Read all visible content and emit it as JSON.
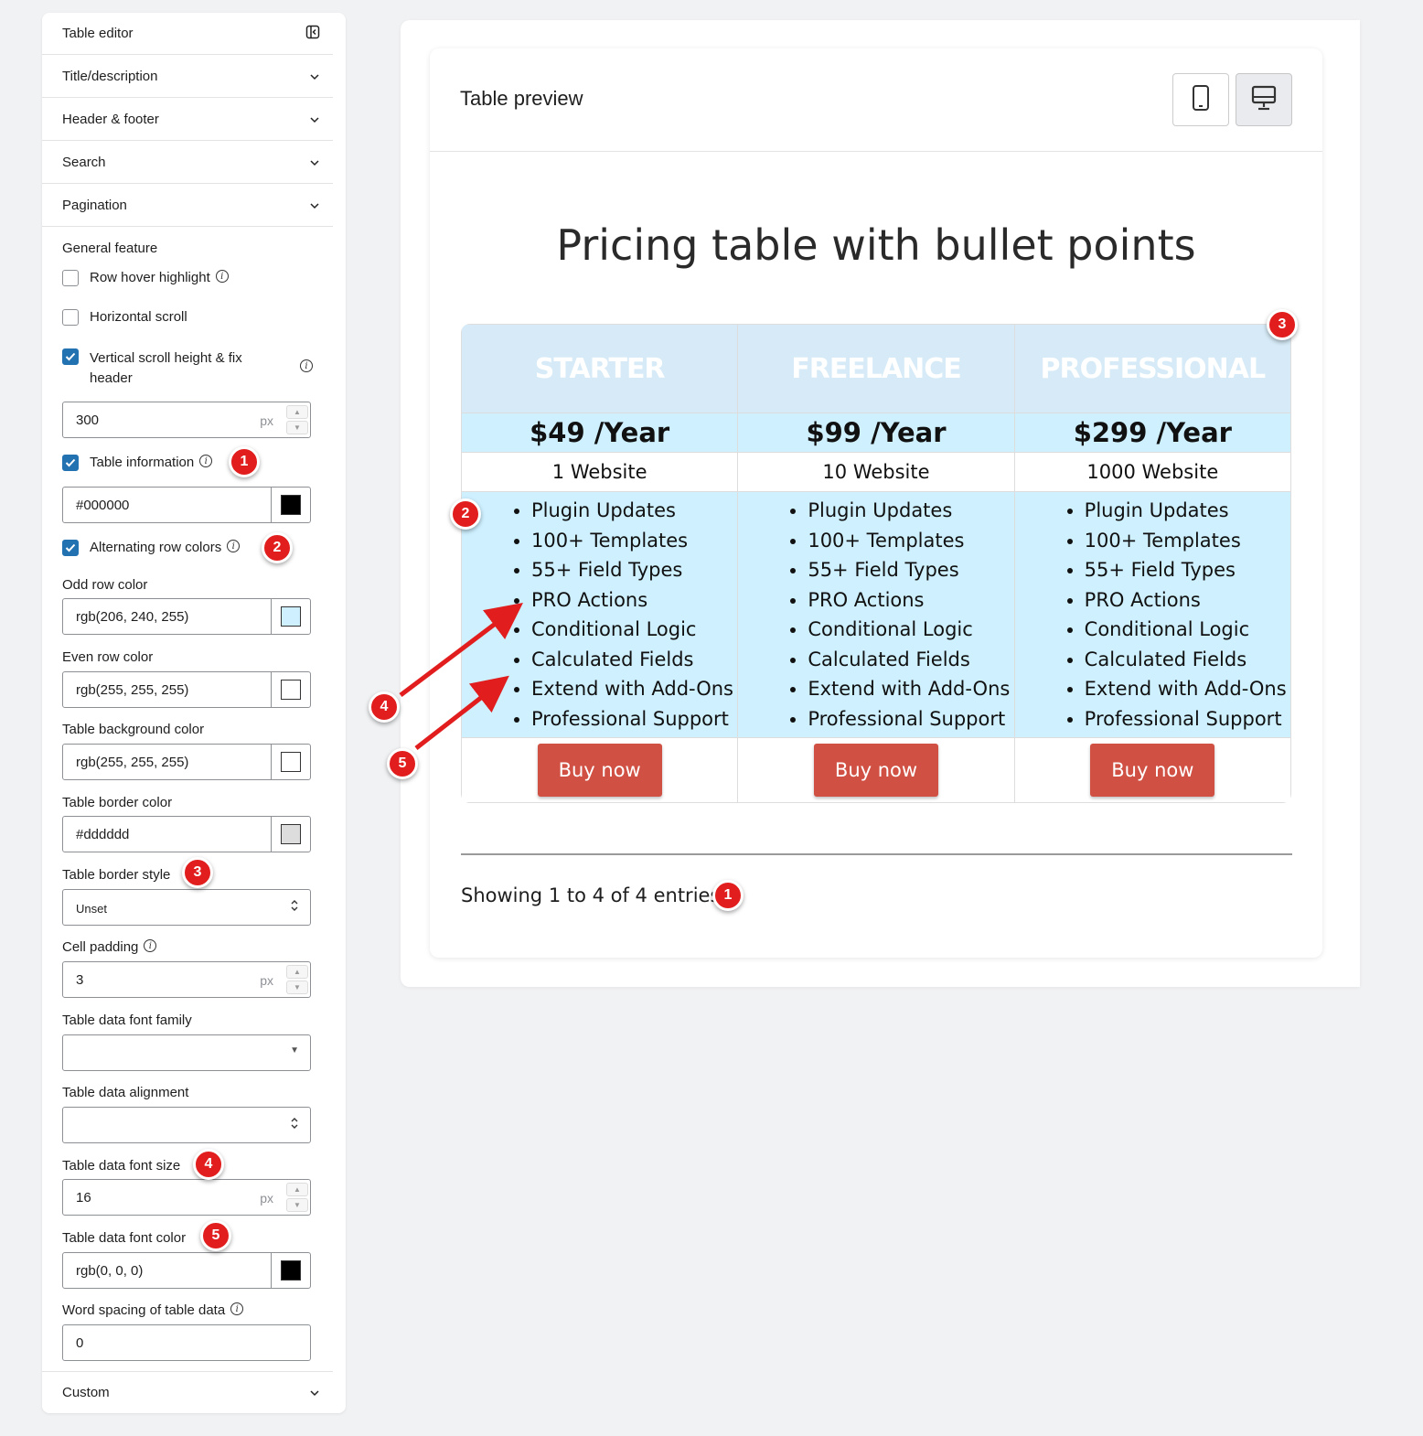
{
  "sidebar": {
    "title": "Table editor",
    "sections": [
      "Title/description",
      "Header & footer",
      "Search",
      "Pagination"
    ],
    "general_feature_label": "General feature",
    "row_hover_highlight": "Row hover highlight",
    "horizontal_scroll": "Horizontal scroll",
    "vertical_scroll": "Vertical scroll height & fix header",
    "vertical_scroll_line1": "Vertical scroll height & fix",
    "vertical_scroll_line2": "header",
    "scroll_height_value": "300",
    "unit_px": "px",
    "table_information": "Table information",
    "info_color_value": "#000000",
    "alternating_row_colors": "Alternating row colors",
    "odd_row_color_label": "Odd row color",
    "odd_row_color_value": "rgb(206, 240, 255)",
    "even_row_color_label": "Even row color",
    "even_row_color_value": "rgb(255, 255, 255)",
    "table_bg_color_label": "Table background color",
    "table_bg_color_value": "rgb(255, 255, 255)",
    "table_border_color_label": "Table border color",
    "table_border_color_value": "#dddddd",
    "table_border_style_label": "Table border style",
    "table_border_style_value": "Unset",
    "cell_padding_label": "Cell padding",
    "cell_padding_value": "3",
    "font_family_label": "Table data font family",
    "font_family_value": "",
    "alignment_label": "Table data alignment",
    "alignment_value": "",
    "font_size_label": "Table data font size",
    "font_size_value": "16",
    "font_color_label": "Table data font color",
    "font_color_value": "rgb(0, 0, 0)",
    "word_spacing_label": "Word spacing of table data",
    "word_spacing_value": "0",
    "custom_section": "Custom"
  },
  "colors": {
    "info_swatch": "#000000",
    "odd_swatch": "#cef0ff",
    "even_swatch": "#ffffff",
    "bg_swatch": "#ffffff",
    "border_swatch": "#dddddd",
    "font_swatch": "#000000",
    "checkbox_blue": "#2271b1",
    "buy_button": "#d05144",
    "annotation_red": "#e11d1d"
  },
  "preview": {
    "header_title": "Table preview",
    "mobile_icon": "mobile-icon",
    "desktop_icon": "desktop-icon",
    "table_title": "Pricing table with bullet points",
    "plans": [
      {
        "name": "STARTER",
        "price": "$49 /Year",
        "sites": "1 Website"
      },
      {
        "name": "FREELANCE",
        "price": "$99 /Year",
        "sites": "10 Website"
      },
      {
        "name": "PROFESSIONAL",
        "price": "$299 /Year",
        "sites": "1000 Website"
      }
    ],
    "features": [
      "Plugin Updates",
      "100+ Templates",
      "55+ Field Types",
      "PRO Actions",
      "Conditional Logic",
      "Calculated Fields",
      "Extend with Add-Ons",
      "Professional Support"
    ],
    "buy_label": "Buy now",
    "showing_text": "Showing 1 to 4 of 4 entries"
  },
  "annotations": {
    "sidebar": [
      "1",
      "2",
      "3",
      "4",
      "5"
    ],
    "preview": [
      "1",
      "2",
      "3",
      "4",
      "5"
    ]
  }
}
